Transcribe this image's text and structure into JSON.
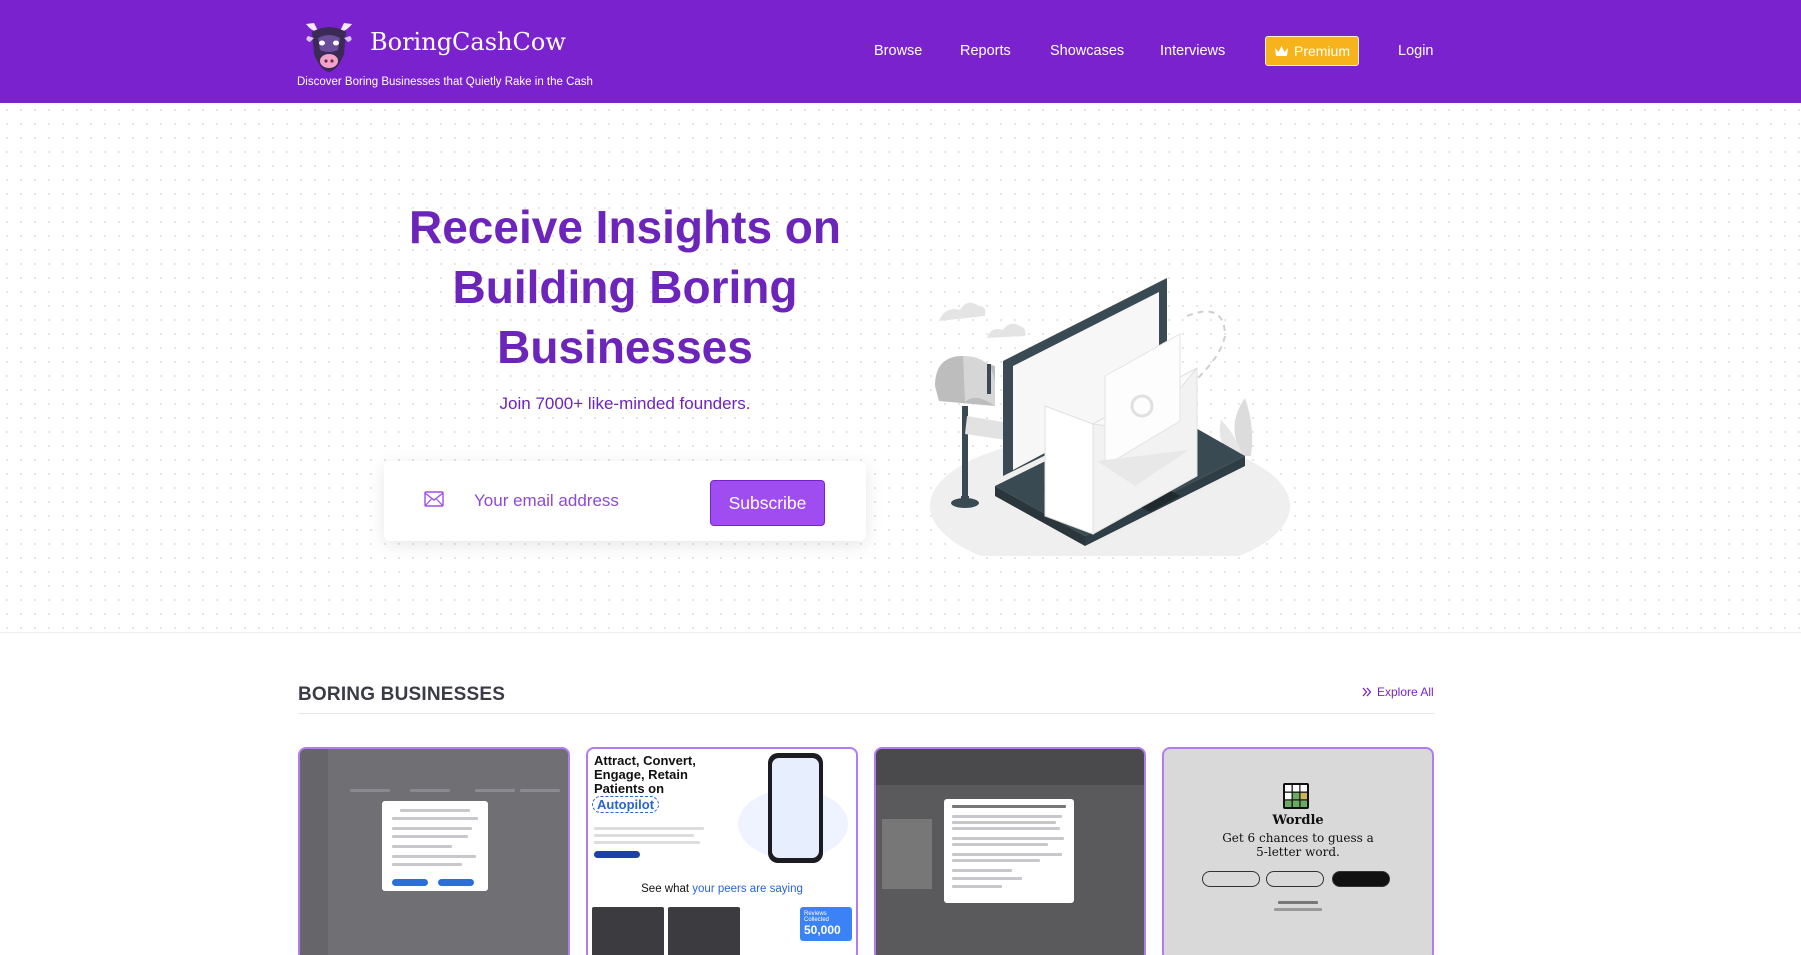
{
  "header": {
    "brand": "BoringCashCow",
    "tagline": "Discover Boring Businesses that Quietly Rake in the Cash",
    "nav": [
      "Browse",
      "Reports",
      "Showcases",
      "Interviews"
    ],
    "premium_label": "Premium",
    "login_label": "Login",
    "colors": {
      "bar": "#7b22cf",
      "premium": "#f7b31c"
    }
  },
  "hero": {
    "title": "Receive Insights on Building Boring Businesses",
    "subtitle": "Join 7000+ like-minded founders.",
    "email_placeholder": "Your email address",
    "subscribe_label": "Subscribe"
  },
  "section": {
    "title": "BORING BUSINESSES",
    "explore_label": "Explore All"
  },
  "cards": {
    "card2": {
      "headline": "Attract, Convert, Engage, Retain Patients on",
      "highlight": "Autopilot",
      "peers_prefix": "See what",
      "peers_highlight": "your peers are saying",
      "stat_label": "Reviews Collected",
      "stat_value": "50,000"
    },
    "card4": {
      "title": "Wordle",
      "description": "Get 6 chances to guess a 5-letter word."
    }
  }
}
